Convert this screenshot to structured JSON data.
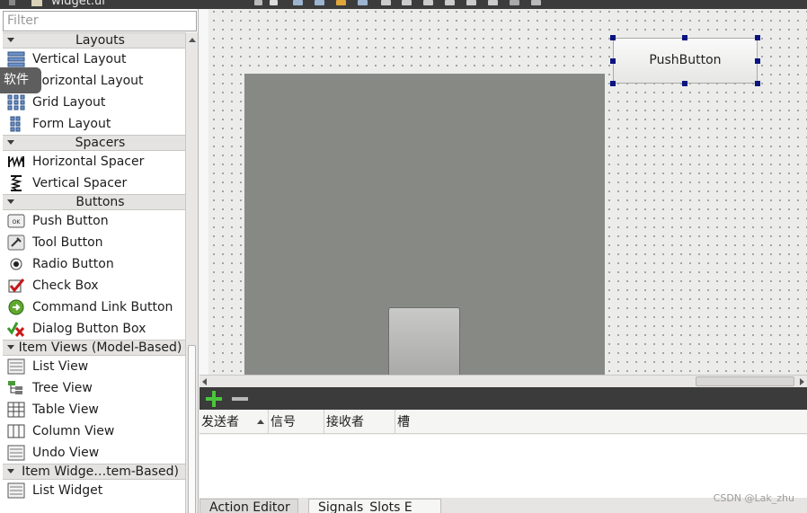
{
  "window": {
    "title": "widget.ui"
  },
  "widget_box": {
    "filter_placeholder": "Filter",
    "tooltip": "软件",
    "categories": [
      {
        "label": "Layouts",
        "items": [
          "Vertical Layout",
          "Horizontal Layout",
          "Grid Layout",
          "Form Layout"
        ]
      },
      {
        "label": "Spacers",
        "items": [
          "Horizontal Spacer",
          "Vertical Spacer"
        ]
      },
      {
        "label": "Buttons",
        "items": [
          "Push Button",
          "Tool Button",
          "Radio Button",
          "Check Box",
          "Command Link Button",
          "Dialog Button Box"
        ]
      },
      {
        "label": "Item Views (Model-Based)",
        "items": [
          "List View",
          "Tree View",
          "Table View",
          "Column View",
          "Undo View"
        ]
      },
      {
        "label": "Item Widge…tem-Based)",
        "items": [
          "List Widget"
        ]
      }
    ]
  },
  "form": {
    "push_button_label": "PushButton"
  },
  "signal_slot_editor": {
    "columns": [
      "发送者",
      "信号",
      "接收者",
      "槽"
    ],
    "tabs": [
      "Action Editor",
      "Signals_Slots E"
    ]
  },
  "watermark": "CSDN @Lak_zhu",
  "colors": {
    "selection_handle": "#0a1580",
    "container_fill": "#878985",
    "add_icon": "#4bc63c"
  }
}
